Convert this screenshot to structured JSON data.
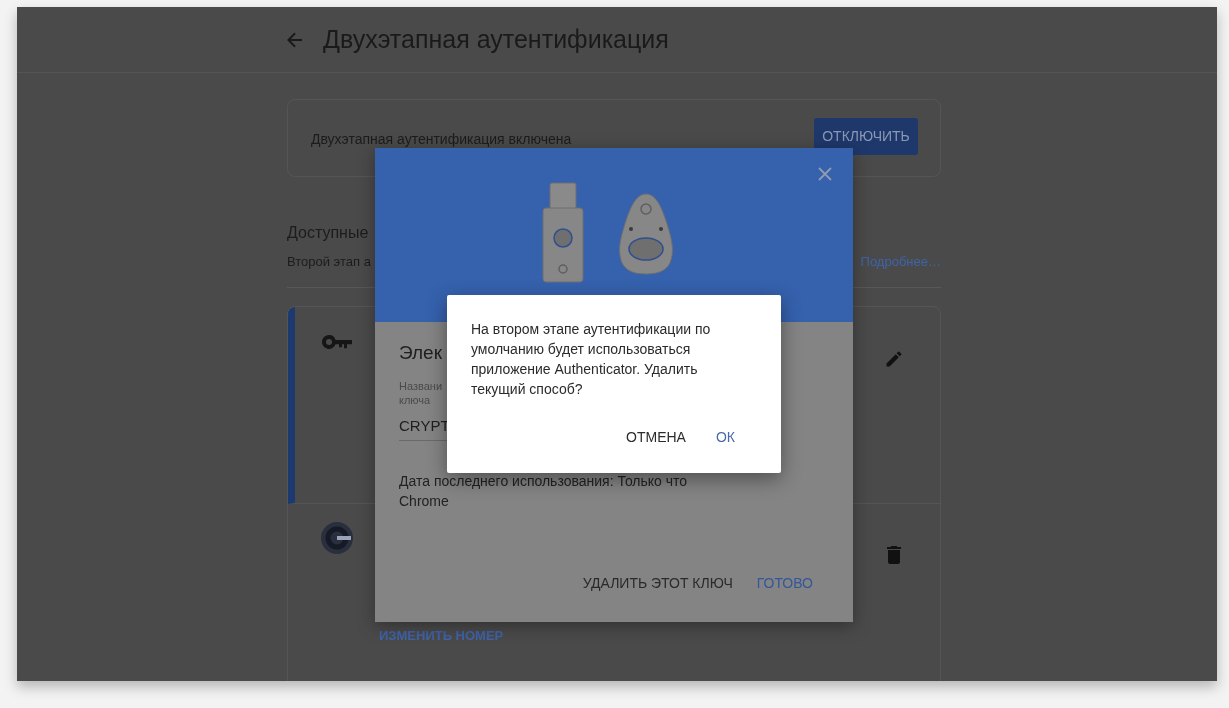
{
  "header": {
    "title": "Двухэтапная аутентификация"
  },
  "status_card": {
    "text": "Двухэтапная аутентификация включена",
    "button": "ОТКЛЮЧИТЬ"
  },
  "methods": {
    "heading": "Доступные",
    "description": "Второй этап а",
    "link": "Подробнее…"
  },
  "method_rows": [
    {
      "kind": "key",
      "selected": true
    },
    {
      "kind": "phone",
      "selected": false,
      "link": "ИЗМЕНИТЬ НОМЕР"
    }
  ],
  "edit_dialog": {
    "title": "Элек",
    "field_label": [
      "Названи",
      "ключа"
    ],
    "field_value": "CRYPT",
    "last_used": "Дата последнего использования: Только что",
    "browser": "Chrome",
    "buttons": [
      "УДАЛИТЬ ЭТОТ КЛЮЧ",
      "ГОТОВО"
    ]
  },
  "confirm_dialog": {
    "message": "На втором этапе аутентификации по умолчанию будет использоваться приложение Authenticator. Удалить текущий способ?",
    "buttons": [
      "ОТМЕНА",
      "ОК"
    ]
  }
}
